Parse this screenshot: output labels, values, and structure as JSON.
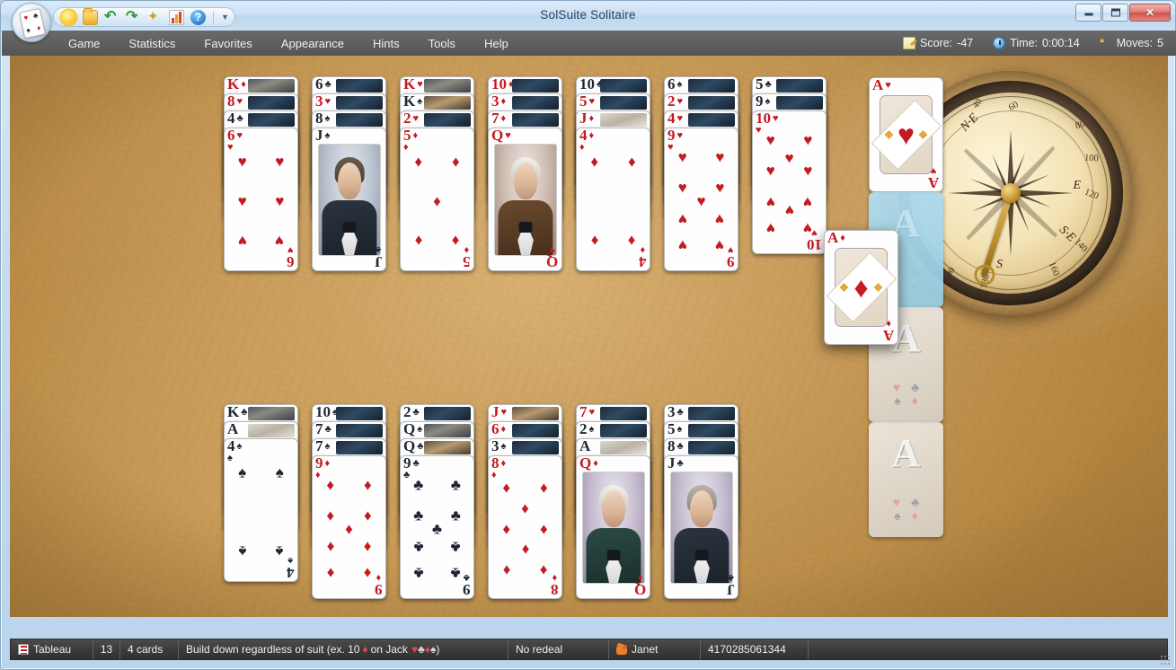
{
  "window": {
    "title": "SolSuite Solitaire",
    "buttons": {
      "minimize": "minimize-button",
      "maximize": "maximize-button",
      "close": "✕"
    }
  },
  "toolbar": {
    "icons": [
      "sun-icon",
      "folder-open-icon",
      "undo-icon",
      "redo-icon",
      "wand-icon",
      "statistics-chart-icon",
      "help-icon"
    ],
    "overflow": "▼"
  },
  "menu": {
    "items": [
      {
        "label": "Game"
      },
      {
        "label": "Statistics"
      },
      {
        "label": "Favorites"
      },
      {
        "label": "Appearance"
      },
      {
        "label": "Hints"
      },
      {
        "label": "Tools"
      },
      {
        "label": "Help"
      }
    ]
  },
  "status_header": {
    "score_label": "Score:",
    "score_value": "-47",
    "time_label": "Time:",
    "time_value": "0:00:14",
    "moves_label": "Moves:",
    "moves_value": "5"
  },
  "statusbar": {
    "pile_type": "Tableau",
    "pile_count": "13",
    "cards_per_pile": "4 cards",
    "rule_prefix": "Build down regardless of suit (ex. 10",
    "rule_suit1": "♦",
    "rule_mid": "on Jack",
    "rule_suits": "♥♣♦♠",
    "rule_suffix": ")",
    "redeal": "No redeal",
    "player": "Janet",
    "game_id": "4170285061344"
  },
  "compass": {
    "labels": [
      "N·E",
      "E",
      "S·E",
      "S"
    ],
    "numbers": [
      "40",
      "60",
      "80",
      "100",
      "120",
      "140",
      "160",
      "180",
      "200"
    ]
  },
  "board": {
    "tableau_top": [
      {
        "cards": [
          {
            "rank": "K",
            "suit": "♦",
            "color": "red",
            "state": "covered",
            "back": "blur"
          },
          {
            "rank": "8",
            "suit": "♥",
            "color": "red",
            "state": "covered"
          },
          {
            "rank": "4",
            "suit": "♣",
            "color": "blk",
            "state": "covered"
          },
          {
            "rank": "6",
            "suit": "♥",
            "color": "red",
            "state": "open"
          }
        ]
      },
      {
        "cards": [
          {
            "rank": "6",
            "suit": "♣",
            "color": "blk",
            "state": "covered"
          },
          {
            "rank": "3",
            "suit": "♥",
            "color": "red",
            "state": "covered"
          },
          {
            "rank": "8",
            "suit": "♠",
            "color": "blk",
            "state": "covered"
          },
          {
            "rank": "J",
            "suit": "♠",
            "color": "blk",
            "state": "open",
            "face": "jack-dark-hair-navy-coat"
          }
        ]
      },
      {
        "cards": [
          {
            "rank": "K",
            "suit": "♥",
            "color": "red",
            "state": "covered",
            "back": "blur"
          },
          {
            "rank": "K",
            "suit": "♠",
            "color": "blk",
            "state": "covered",
            "back": "warm"
          },
          {
            "rank": "2",
            "suit": "♥",
            "color": "red",
            "state": "covered"
          },
          {
            "rank": "5",
            "suit": "♦",
            "color": "red",
            "state": "open"
          }
        ]
      },
      {
        "cards": [
          {
            "rank": "10",
            "suit": "♦",
            "color": "red",
            "state": "covered"
          },
          {
            "rank": "3",
            "suit": "♦",
            "color": "red",
            "state": "covered"
          },
          {
            "rank": "7",
            "suit": "♦",
            "color": "red",
            "state": "covered"
          },
          {
            "rank": "Q",
            "suit": "♥",
            "color": "red",
            "state": "open",
            "face": "queen-white-hair-brown-coat"
          }
        ]
      },
      {
        "cards": [
          {
            "rank": "10",
            "suit": "♣",
            "color": "blk",
            "state": "covered"
          },
          {
            "rank": "5",
            "suit": "♥",
            "color": "red",
            "state": "covered"
          },
          {
            "rank": "J",
            "suit": "♦",
            "color": "red",
            "state": "covered",
            "back": "pale"
          },
          {
            "rank": "4",
            "suit": "♦",
            "color": "red",
            "state": "open"
          }
        ]
      },
      {
        "cards": [
          {
            "rank": "6",
            "suit": "♠",
            "color": "blk",
            "state": "covered"
          },
          {
            "rank": "2",
            "suit": "♥",
            "color": "red",
            "state": "covered"
          },
          {
            "rank": "4",
            "suit": "♥",
            "color": "red",
            "state": "covered"
          },
          {
            "rank": "9",
            "suit": "♥",
            "color": "red",
            "state": "open"
          }
        ]
      },
      {
        "cards": [
          {
            "rank": "5",
            "suit": "♣",
            "color": "blk",
            "state": "covered"
          },
          {
            "rank": "9",
            "suit": "♠",
            "color": "blk",
            "state": "covered"
          },
          {
            "rank": "10",
            "suit": "♥",
            "color": "red",
            "state": "open"
          }
        ]
      }
    ],
    "tableau_bottom": [
      {
        "cards": [
          {
            "rank": "K",
            "suit": "♣",
            "color": "blk",
            "state": "covered",
            "back": "blur"
          },
          {
            "rank": "A",
            "suit": "",
            "color": "blk",
            "state": "covered",
            "back": "pale"
          },
          {
            "rank": "4",
            "suit": "♠",
            "color": "blk",
            "state": "open"
          }
        ]
      },
      {
        "cards": [
          {
            "rank": "10",
            "suit": "♠",
            "color": "blk",
            "state": "covered"
          },
          {
            "rank": "7",
            "suit": "♣",
            "color": "blk",
            "state": "covered"
          },
          {
            "rank": "7",
            "suit": "♠",
            "color": "blk",
            "state": "covered"
          },
          {
            "rank": "9",
            "suit": "♦",
            "color": "red",
            "state": "open"
          }
        ]
      },
      {
        "cards": [
          {
            "rank": "2",
            "suit": "♣",
            "color": "blk",
            "state": "covered"
          },
          {
            "rank": "Q",
            "suit": "♠",
            "color": "blk",
            "state": "covered",
            "back": "blur"
          },
          {
            "rank": "Q",
            "suit": "♣",
            "color": "blk",
            "state": "covered",
            "back": "warm"
          },
          {
            "rank": "9",
            "suit": "♣",
            "color": "blk",
            "state": "open"
          }
        ]
      },
      {
        "cards": [
          {
            "rank": "J",
            "suit": "♥",
            "color": "red",
            "state": "covered",
            "back": "warm"
          },
          {
            "rank": "6",
            "suit": "♦",
            "color": "red",
            "state": "covered"
          },
          {
            "rank": "3",
            "suit": "♠",
            "color": "blk",
            "state": "covered"
          },
          {
            "rank": "8",
            "suit": "♦",
            "color": "red",
            "state": "open"
          }
        ]
      },
      {
        "cards": [
          {
            "rank": "7",
            "suit": "♥",
            "color": "red",
            "state": "covered"
          },
          {
            "rank": "2",
            "suit": "♠",
            "color": "blk",
            "state": "covered"
          },
          {
            "rank": "A",
            "suit": "",
            "color": "blk",
            "state": "covered",
            "back": "pale"
          },
          {
            "rank": "Q",
            "suit": "♦",
            "color": "red",
            "state": "open",
            "face": "queen-white-hair-green-coat"
          }
        ]
      },
      {
        "cards": [
          {
            "rank": "3",
            "suit": "♣",
            "color": "blk",
            "state": "covered"
          },
          {
            "rank": "5",
            "suit": "♠",
            "color": "blk",
            "state": "covered"
          },
          {
            "rank": "8",
            "suit": "♣",
            "color": "blk",
            "state": "covered"
          },
          {
            "rank": "J",
            "suit": "♣",
            "color": "blk",
            "state": "open",
            "face": "jack-grey-hair-black-coat"
          }
        ]
      }
    ],
    "foundations": [
      {
        "state": "card",
        "rank": "A",
        "suit": "♥",
        "color": "red"
      },
      {
        "state": "empty-highlight",
        "placeholder": "A"
      },
      {
        "state": "empty",
        "placeholder": "A"
      },
      {
        "state": "empty",
        "placeholder": "A"
      }
    ],
    "dragged_card": {
      "rank": "A",
      "suit": "♦",
      "color": "red"
    }
  }
}
